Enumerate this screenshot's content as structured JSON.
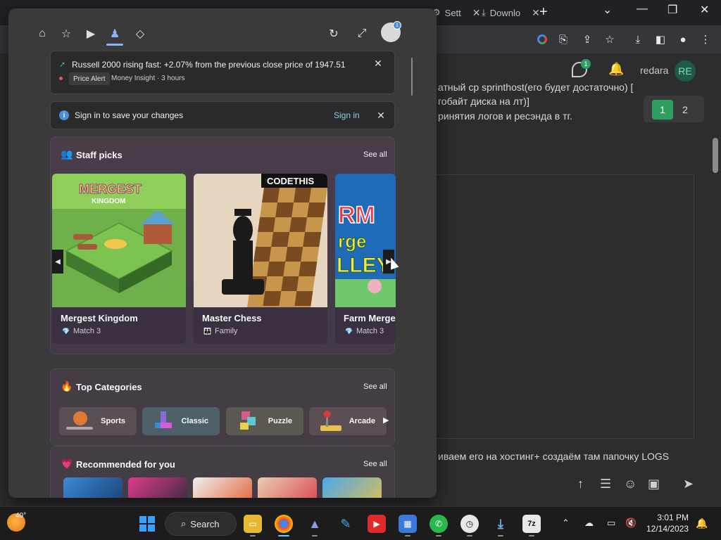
{
  "chrome": {
    "tabs": [
      {
        "label": "Sett",
        "icon": "gear-icon"
      },
      {
        "label": "Downlo",
        "icon": "download-icon"
      }
    ],
    "toolbar_icons": [
      "google-icon",
      "translate-icon",
      "share-icon",
      "star-icon",
      "download-icon",
      "sidepanel-icon",
      "profile-icon",
      "menu-icon"
    ]
  },
  "background_page": {
    "user": "redara",
    "avatar_initials": "RE",
    "chat_badge": "1",
    "lines": [
      "атный ср sprinthost(его будет достаточно) [",
      "гобайт диска на лт)]",
      "ринятия логов и ресэнда в тг.",
      "иваем его на хостинг+ создаём там папочку LOGS"
    ],
    "pages": [
      "1",
      "2"
    ]
  },
  "panel": {
    "nav": [
      "home-icon",
      "favorites-icon",
      "video-icon",
      "games-icon",
      "tag-icon"
    ],
    "avatar_badge": "1",
    "alert": {
      "text": "Russell 2000 rising fast: +2.07% from the previous close price of 1947.51",
      "chip": "Price Alert",
      "source": "Money Insight · 3 hours"
    },
    "signin": {
      "text": "Sign in to save your changes",
      "link": "Sign in"
    },
    "staff": {
      "title": "Staff picks",
      "see_all": "See all",
      "games": [
        {
          "name": "Mergest Kingdom",
          "category": "Match 3",
          "art_text": "MERGEST KINGDOM"
        },
        {
          "name": "Master Chess",
          "category": "Family",
          "art_text": "CODETHIS"
        },
        {
          "name": "Farm Merge",
          "category": "Match 3",
          "art_text": "RM rge LLEY"
        }
      ]
    },
    "categories": {
      "title": "Top Categories",
      "see_all": "See all",
      "items": [
        "Sports",
        "Classic",
        "Puzzle",
        "Arcade"
      ]
    },
    "recommended": {
      "title": "Recommended for you",
      "see_all": "See all"
    }
  },
  "taskbar": {
    "temp": "40°",
    "search": "Search",
    "time": "3:01 PM",
    "date": "12/14/2023"
  },
  "colors": {
    "accent": "#8ab4f8",
    "green": "#2e9e63",
    "panel_bg": "#3a3a3a"
  }
}
